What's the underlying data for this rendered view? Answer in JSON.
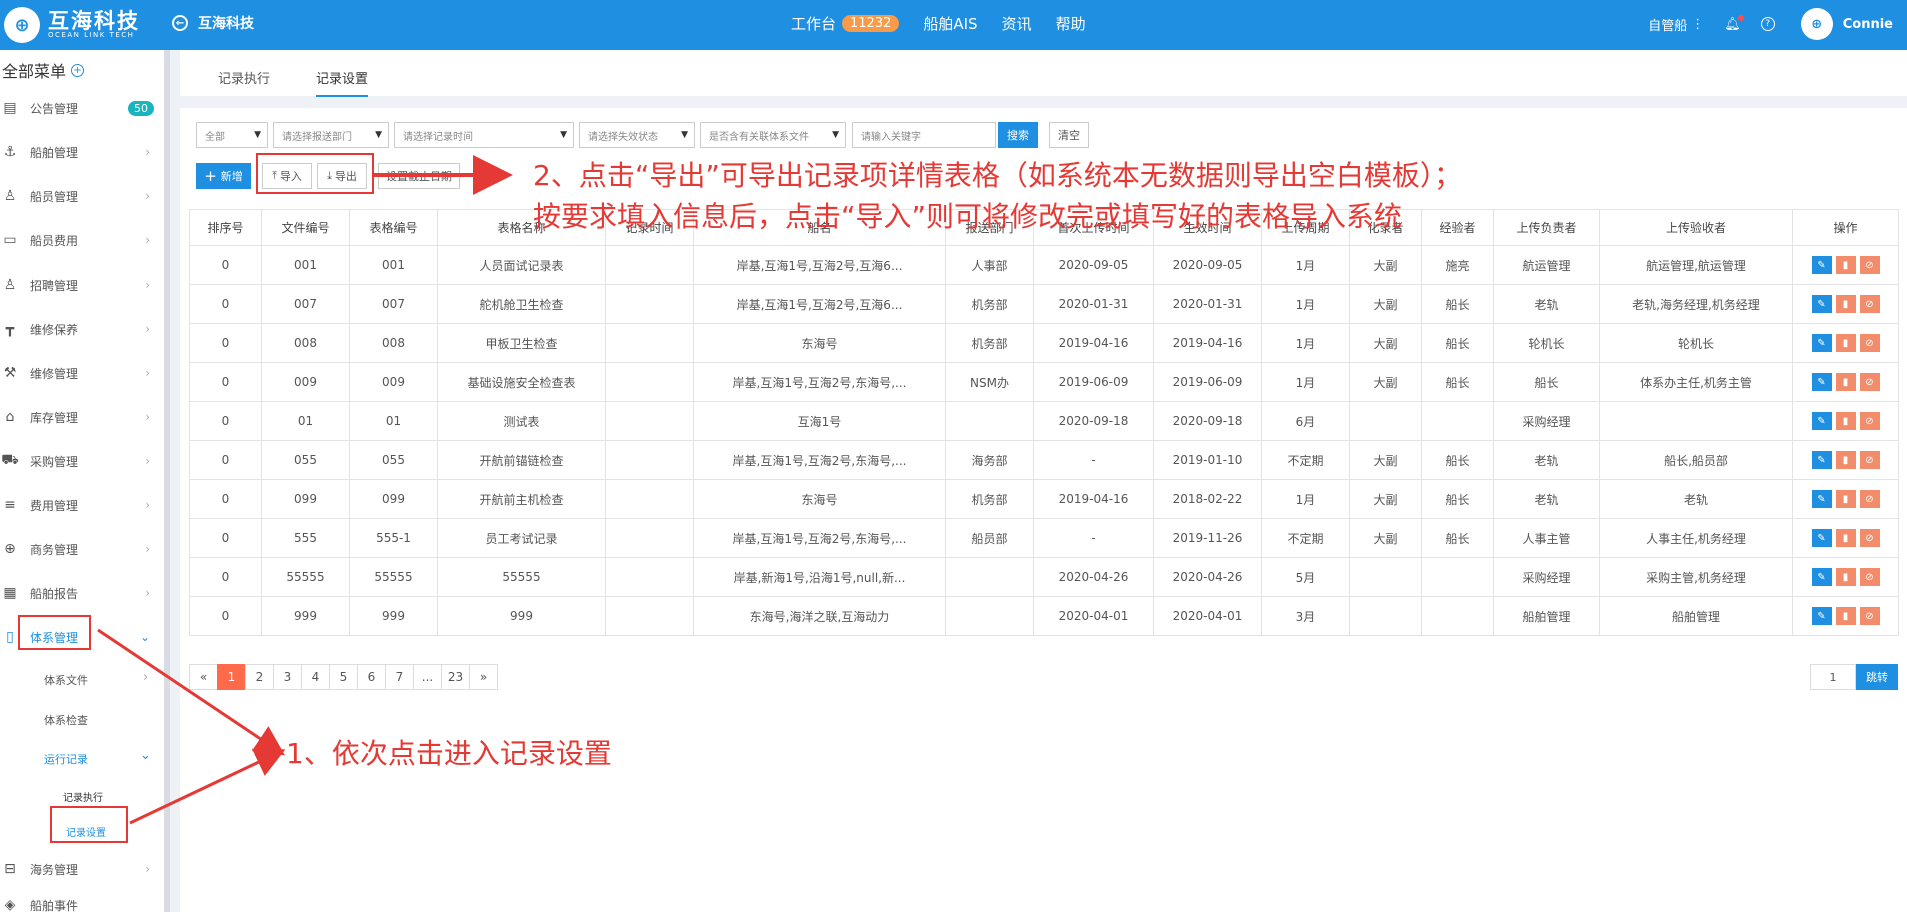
{
  "header": {
    "logo_cn": "互海科技",
    "logo_en": "OCEAN LINK TECH",
    "back_title": "互海科技",
    "nav": [
      "工作台",
      "船舶AIS",
      "资讯",
      "帮助"
    ],
    "workbench_count": "11232",
    "ship_mode": "自管船",
    "user": "Connie"
  },
  "sidebar": {
    "title": "全部菜单",
    "notice_count": "50",
    "items": [
      "公告管理",
      "船舶管理",
      "船员管理",
      "船员费用",
      "招聘管理",
      "维修保养",
      "维修管理",
      "库存管理",
      "采购管理",
      "费用管理",
      "商务管理",
      "船舶报告",
      "体系管理",
      "海务管理",
      "船舶事件"
    ],
    "sub": {
      "docs": "体系文件",
      "check": "体系检查",
      "run": "运行记录",
      "exec": "记录执行",
      "settings": "记录设置"
    }
  },
  "tabs": [
    "记录执行",
    "记录设置"
  ],
  "filters": {
    "all": "全部",
    "dept": "请选择报送部门",
    "time": "请选择记录时间",
    "status": "请选择失效状态",
    "linked": "是否含有关联体系文件",
    "keyword_placeholder": "请输入关键字",
    "search": "搜索",
    "clear": "清空"
  },
  "toolbar": {
    "add": "新增",
    "import": "导入",
    "export": "导出",
    "set_time": "设置截止日期"
  },
  "annotations": {
    "a2_line1": "2、点击“导出”可导出记录项详情表格（如系统本无数据则导出空白模板）；",
    "a2_line2": "按要求填入信息后，点击“导入”则可将修改完或填写好的表格导入系统",
    "a1": "1、依次点击进入记录设置"
  },
  "table": {
    "headers": [
      "排序号",
      "文件编号",
      "表格编号",
      "表格名称",
      "记录时间",
      "船名",
      "报送部门",
      "首次上传时间",
      "生效时间",
      "上传周期",
      "化录者",
      "经验者",
      "上传负责者",
      "上传验收者",
      "操作"
    ],
    "rows": [
      [
        "0",
        "001",
        "001",
        "人员面试记录表",
        "",
        "岸基,互海1号,互海2号,互海6...",
        "人事部",
        "2020-09-05",
        "2020-09-05",
        "1月",
        "大副",
        "施亮",
        "航运管理",
        "航运管理,航运管理"
      ],
      [
        "0",
        "007",
        "007",
        "舵机舱卫生检查",
        "",
        "岸基,互海1号,互海2号,互海6...",
        "机务部",
        "2020-01-31",
        "2020-01-31",
        "1月",
        "大副",
        "船长",
        "老轨",
        "老轨,海务经理,机务经理"
      ],
      [
        "0",
        "008",
        "008",
        "甲板卫生检查",
        "",
        "东海号",
        "机务部",
        "2019-04-16",
        "2019-04-16",
        "1月",
        "大副",
        "船长",
        "轮机长",
        "轮机长"
      ],
      [
        "0",
        "009",
        "009",
        "基础设施安全检查表",
        "",
        "岸基,互海1号,互海2号,东海号,...",
        "NSM办",
        "2019-06-09",
        "2019-06-09",
        "1月",
        "大副",
        "船长",
        "船长",
        "体系办主任,机务主管"
      ],
      [
        "0",
        "01",
        "01",
        "测试表",
        "",
        "互海1号",
        "",
        "2020-09-18",
        "2020-09-18",
        "6月",
        "",
        "",
        "采购经理",
        ""
      ],
      [
        "0",
        "055",
        "055",
        "开航前锚链检查",
        "",
        "岸基,互海1号,互海2号,东海号,...",
        "海务部",
        "-",
        "2019-01-10",
        "不定期",
        "大副",
        "船长",
        "老轨",
        "船长,船员部"
      ],
      [
        "0",
        "099",
        "099",
        "开航前主机检查",
        "",
        "东海号",
        "机务部",
        "2019-04-16",
        "2018-02-22",
        "1月",
        "大副",
        "船长",
        "老轨",
        "老轨"
      ],
      [
        "0",
        "555",
        "555-1",
        "员工考试记录",
        "",
        "岸基,互海1号,互海2号,东海号,...",
        "船员部",
        "-",
        "2019-11-26",
        "不定期",
        "大副",
        "船长",
        "人事主管",
        "人事主任,机务经理"
      ],
      [
        "0",
        "55555",
        "55555",
        "55555",
        "",
        "岸基,新海1号,沿海1号,null,新...",
        "",
        "2020-04-26",
        "2020-04-26",
        "5月",
        "",
        "",
        "采购经理",
        "采购主管,机务经理"
      ],
      [
        "0",
        "999",
        "999",
        "999",
        "",
        "东海号,海洋之联,互海动力",
        "",
        "2020-04-01",
        "2020-04-01",
        "3月",
        "",
        "",
        "船舶管理",
        "船舶管理"
      ]
    ]
  },
  "pagination": {
    "prev": "«",
    "pages": [
      "1",
      "2",
      "3",
      "4",
      "5",
      "6",
      "7",
      "...",
      "23"
    ],
    "next": "»",
    "jump_value": "1",
    "jump_label": "跳转"
  },
  "colors": {
    "brand_blue": "#1e8fe1",
    "annotation_red": "#e53935",
    "badge_orange": "#f79a4a",
    "badge_teal": "#19b5bf",
    "page_active": "#ff6b4a"
  }
}
